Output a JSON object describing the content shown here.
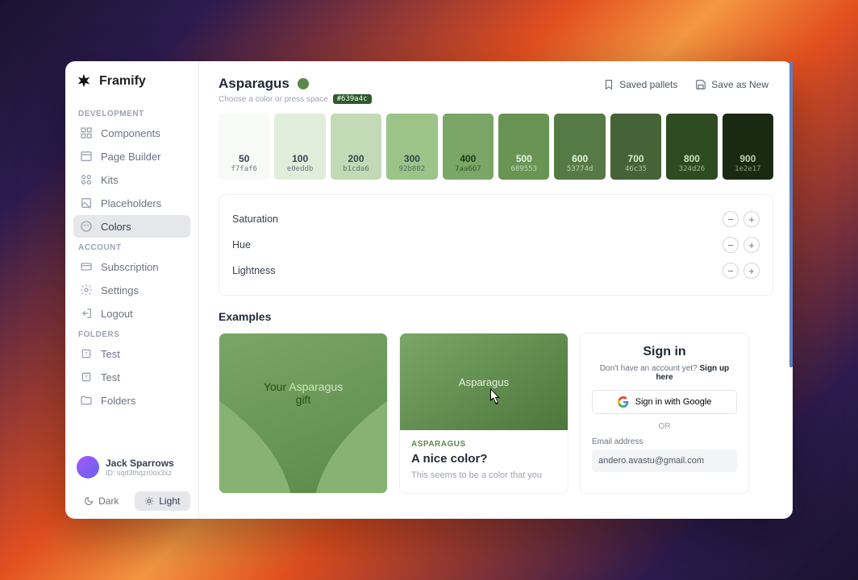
{
  "brand": {
    "name": "Framify"
  },
  "sidebar": {
    "sections": {
      "development_label": "DEVELOPMENT",
      "account_label": "ACCOUNT",
      "folders_label": "FOLDERS"
    },
    "items": {
      "components": "Components",
      "page_builder": "Page Builder",
      "kits": "Kits",
      "placeholders": "Placeholders",
      "colors": "Colors",
      "subscription": "Subscription",
      "settings": "Settings",
      "logout": "Logout",
      "test1": "Test",
      "test2": "Test",
      "folders": "Folders"
    },
    "user": {
      "name": "Jack Sparrows",
      "id": "ID: sqd3thqzr0ox3xz"
    },
    "theme": {
      "dark": "Dark",
      "light": "Light"
    }
  },
  "color": {
    "name": "Asparagus",
    "subtitle": "Choose a color or press space",
    "hex_badge": "#639a4c",
    "dot_color": "#5a8a4a",
    "saved_pallets": "Saved pallets",
    "save_as_new": "Save as New"
  },
  "swatches": [
    {
      "shade": "50",
      "hex": "f7faf6",
      "bg": "#f7faf6",
      "text": "#374151"
    },
    {
      "shade": "100",
      "hex": "e0eddb",
      "bg": "#e0eddb",
      "text": "#374151"
    },
    {
      "shade": "200",
      "hex": "b1cda6",
      "bg": "#c2dab5",
      "text": "#374151"
    },
    {
      "shade": "300",
      "hex": "92b882",
      "bg": "#9cc488",
      "text": "#374151"
    },
    {
      "shade": "400",
      "hex": "7aa667",
      "bg": "#7aa667",
      "text": "#1f3716"
    },
    {
      "shade": "500",
      "hex": "689553",
      "bg": "#689553",
      "text": "#e8f4e2"
    },
    {
      "shade": "600",
      "hex": "53774d",
      "bg": "#567a45",
      "text": "#e8f4e2"
    },
    {
      "shade": "700",
      "hex": "46c35",
      "bg": "#466237",
      "text": "#dcead4"
    },
    {
      "shade": "800",
      "hex": "324d26",
      "bg": "#2f4b21",
      "text": "#cde0c1"
    },
    {
      "shade": "900",
      "hex": "1e2e17",
      "bg": "#1a2a12",
      "text": "#b9d1aa"
    }
  ],
  "sliders": {
    "saturation": "Saturation",
    "hue": "Hue",
    "lightness": "Lightness"
  },
  "examples": {
    "title": "Examples",
    "gift": {
      "prefix": "Your ",
      "highlight": "Asparagus",
      "suffix": " gift"
    },
    "card": {
      "name": "Asparagus",
      "tag": "ASPARAGUS",
      "headline": "A nice color?",
      "desc": "This seems to be a color that you"
    },
    "signin": {
      "title": "Sign in",
      "signup_prefix": "Don't have an account yet? ",
      "signup_link": "Sign up here",
      "google": "Sign in with Google",
      "or": "OR",
      "email_label": "Email address",
      "email_value": "andero.avastu@gmail.com"
    }
  }
}
